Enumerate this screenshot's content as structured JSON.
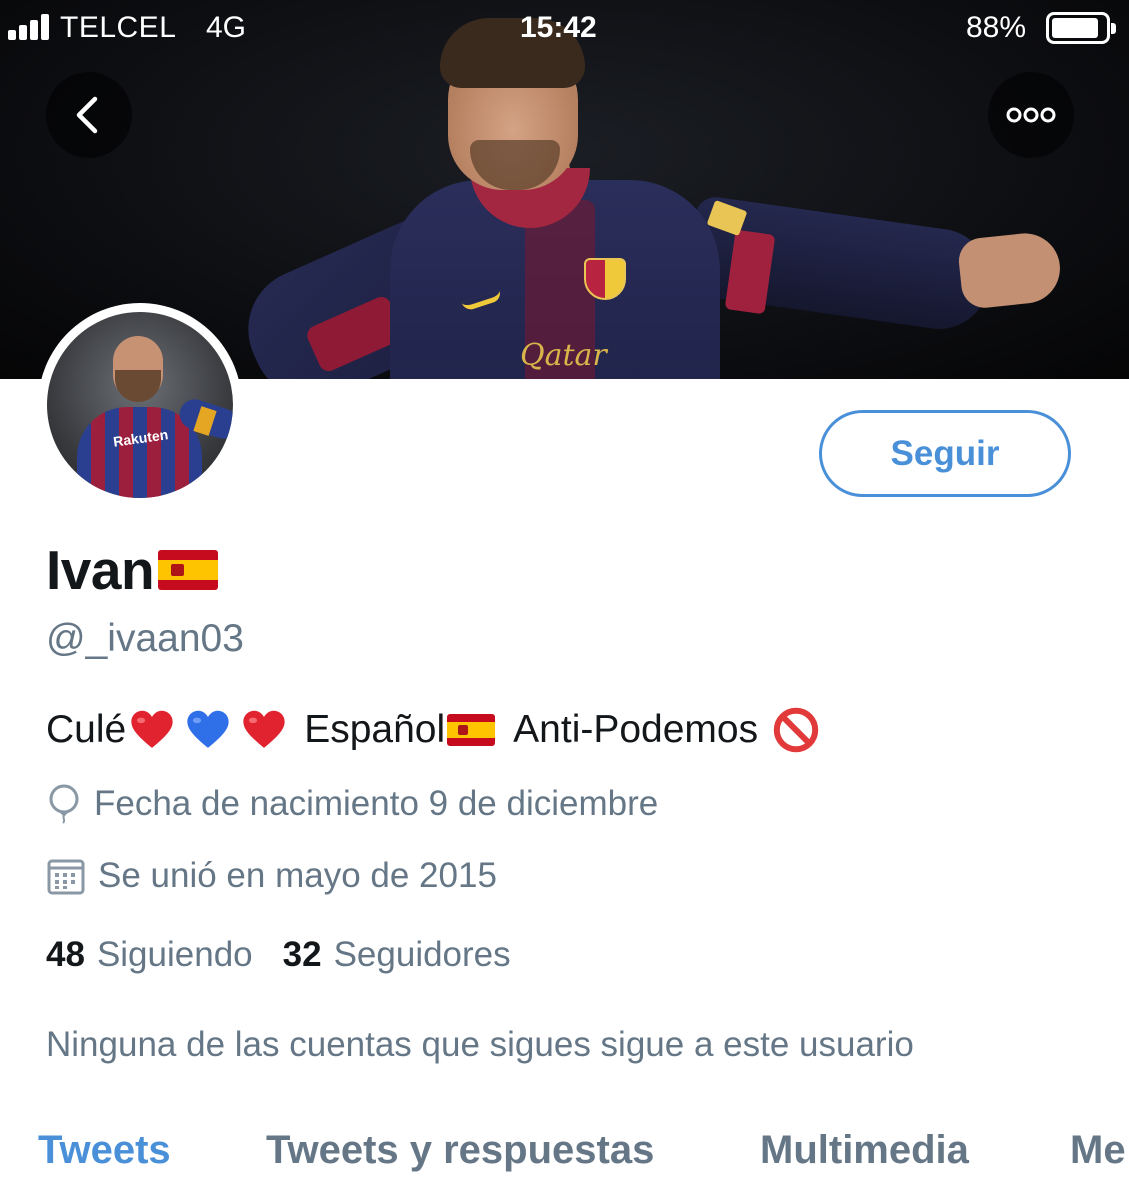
{
  "status_bar": {
    "carrier": "TELCEL",
    "network": "4G",
    "time": "15:42",
    "battery_percent": "88%",
    "battery_level": 0.88,
    "signal_bars": 4
  },
  "header": {
    "back_icon": "chevron-left-icon",
    "more_icon": "more-horizontal-icon",
    "banner_sponsor_text": "Qatar"
  },
  "profile": {
    "display_name": "Ivan",
    "name_emoji": "spain-flag",
    "handle": "@_ivaan03",
    "follow_label": "Seguir",
    "bio": {
      "part1": "Culé",
      "part2": "Español",
      "part3": "Anti-Podemos",
      "emojis": [
        "red-heart",
        "blue-heart",
        "red-heart",
        "spain-flag",
        "no-entry-sign"
      ]
    },
    "birthday": "Fecha de nacimiento 9 de diciembre",
    "joined": "Se unió en mayo de 2015",
    "following_count": "48",
    "following_label": "Siguiendo",
    "followers_count": "32",
    "followers_label": "Seguidores",
    "mutual_text": "Ninguna de las cuentas que sigues sigue a este usuario"
  },
  "tabs": [
    {
      "label": "Tweets",
      "active": true
    },
    {
      "label": "Tweets y respuestas",
      "active": false
    },
    {
      "label": "Multimedia",
      "active": false
    },
    {
      "label": "Me",
      "active": false
    }
  ],
  "colors": {
    "accent": "#4a90d9",
    "text_primary": "#14171a",
    "text_secondary": "#657786"
  }
}
